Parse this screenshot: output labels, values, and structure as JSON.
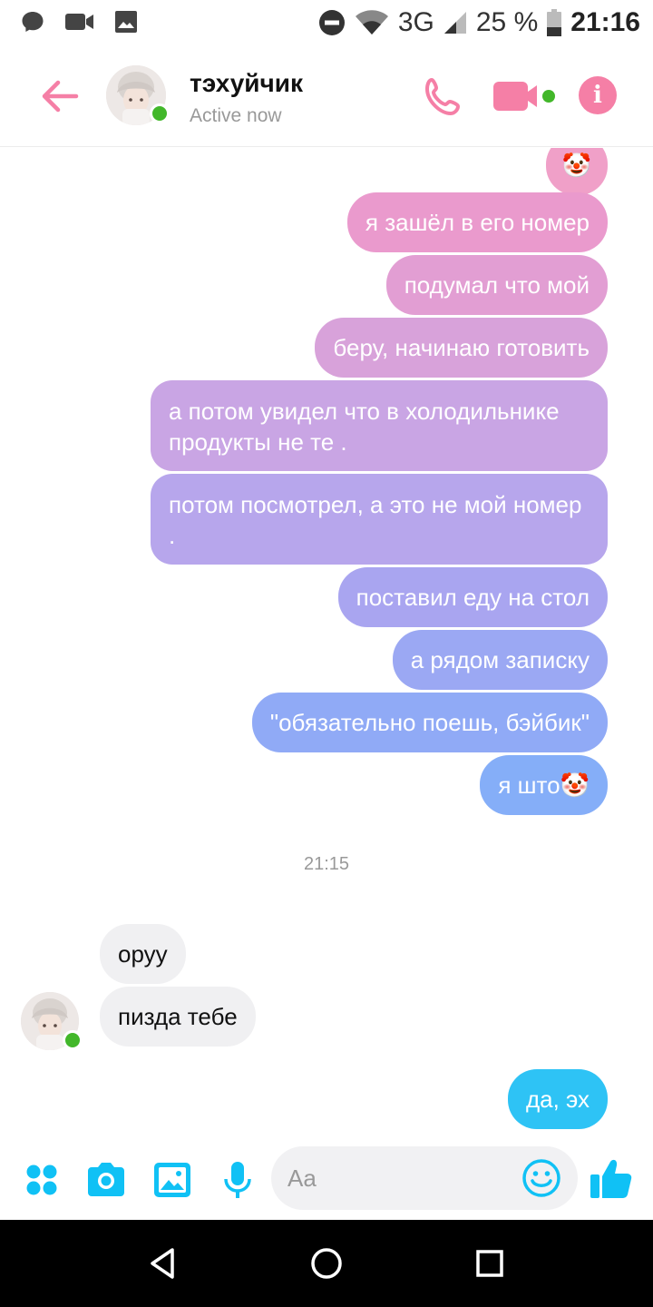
{
  "status_bar": {
    "network": "3G",
    "battery": "25 %",
    "time": "21:16"
  },
  "header": {
    "contact_name": "тэхуйчик",
    "contact_status": "Active now",
    "accent_color": "#f57fa6"
  },
  "messages": {
    "outgoing": [
      {
        "text": "🤡"
      },
      {
        "text": "я зашёл в его номер"
      },
      {
        "text": "подумал что мой"
      },
      {
        "text": "беру, начинаю готовить"
      },
      {
        "text": "а потом увидел что в холодильнике продукты не те ."
      },
      {
        "text": "потом посмотрел, а это не мой номер ."
      },
      {
        "text": "поставил еду на стол"
      },
      {
        "text": "а рядом записку"
      },
      {
        "text": "\"обязательно поешь, бэйбик\""
      },
      {
        "text": "я што🤡"
      }
    ],
    "timestamp": "21:15",
    "incoming": [
      {
        "text": "оруу"
      },
      {
        "text": "пизда тебе"
      }
    ],
    "reply": {
      "text": "да, эх",
      "color": "#2ec3f5"
    }
  },
  "composer": {
    "placeholder": "Aa",
    "icon_color": "#10c1f5",
    "icons": [
      "apps-icon",
      "camera-icon",
      "gallery-icon",
      "microphone-icon",
      "emoji-icon",
      "like-icon"
    ]
  },
  "nav": {
    "icons": [
      "back-triangle-icon",
      "home-circle-icon",
      "recents-square-icon"
    ]
  }
}
